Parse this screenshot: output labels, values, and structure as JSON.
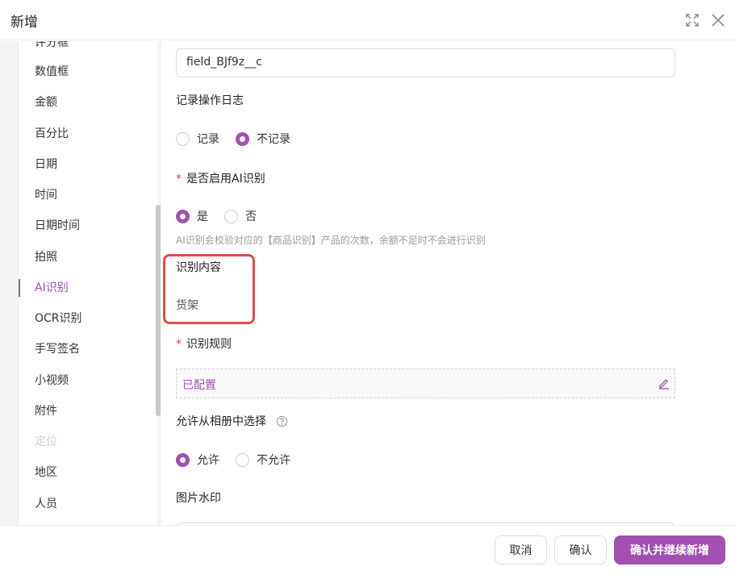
{
  "dialog": {
    "title": "新增"
  },
  "sidebar": {
    "items": [
      {
        "label": "评分框",
        "state": "partial"
      },
      {
        "label": "数值框",
        "state": "normal"
      },
      {
        "label": "金额",
        "state": "normal"
      },
      {
        "label": "百分比",
        "state": "normal"
      },
      {
        "label": "日期",
        "state": "normal"
      },
      {
        "label": "时间",
        "state": "normal"
      },
      {
        "label": "日期时间",
        "state": "normal"
      },
      {
        "label": "拍照",
        "state": "normal"
      },
      {
        "label": "AI识别",
        "state": "active"
      },
      {
        "label": "OCR识别",
        "state": "normal"
      },
      {
        "label": "手写签名",
        "state": "normal"
      },
      {
        "label": "小视频",
        "state": "normal"
      },
      {
        "label": "附件",
        "state": "normal"
      },
      {
        "label": "定位",
        "state": "disabled"
      },
      {
        "label": "地区",
        "state": "normal"
      },
      {
        "label": "人员",
        "state": "normal"
      }
    ]
  },
  "form": {
    "api_name_value": "field_BJf9z__c",
    "log": {
      "label": "记录操作日志",
      "options": [
        "记录",
        "不记录"
      ],
      "selected": "不记录"
    },
    "ai": {
      "required_mark": "*",
      "label": "是否启用AI识别",
      "options": [
        "是",
        "否"
      ],
      "selected": "是",
      "hint": "AI识别会校验对应的【商品识别】产品的次数，余额不足时不会进行识别"
    },
    "content": {
      "label": "识别内容",
      "value": "货架"
    },
    "rules": {
      "required_mark": "*",
      "label": "识别规则",
      "value": "已配置"
    },
    "album": {
      "label": "允许从相册中选择",
      "options": [
        "允许",
        "不允许"
      ],
      "selected": "允许"
    },
    "watermark": {
      "label": "图片水印"
    }
  },
  "footer": {
    "cancel": "取消",
    "confirm": "确认",
    "confirm_continue": "确认并继续新增"
  },
  "colors": {
    "accent": "#a14fb0",
    "highlight": "#e04b4b",
    "required": "#e64545"
  },
  "icons": [
    "expand-icon",
    "close-icon",
    "help-icon",
    "edit-icon"
  ]
}
